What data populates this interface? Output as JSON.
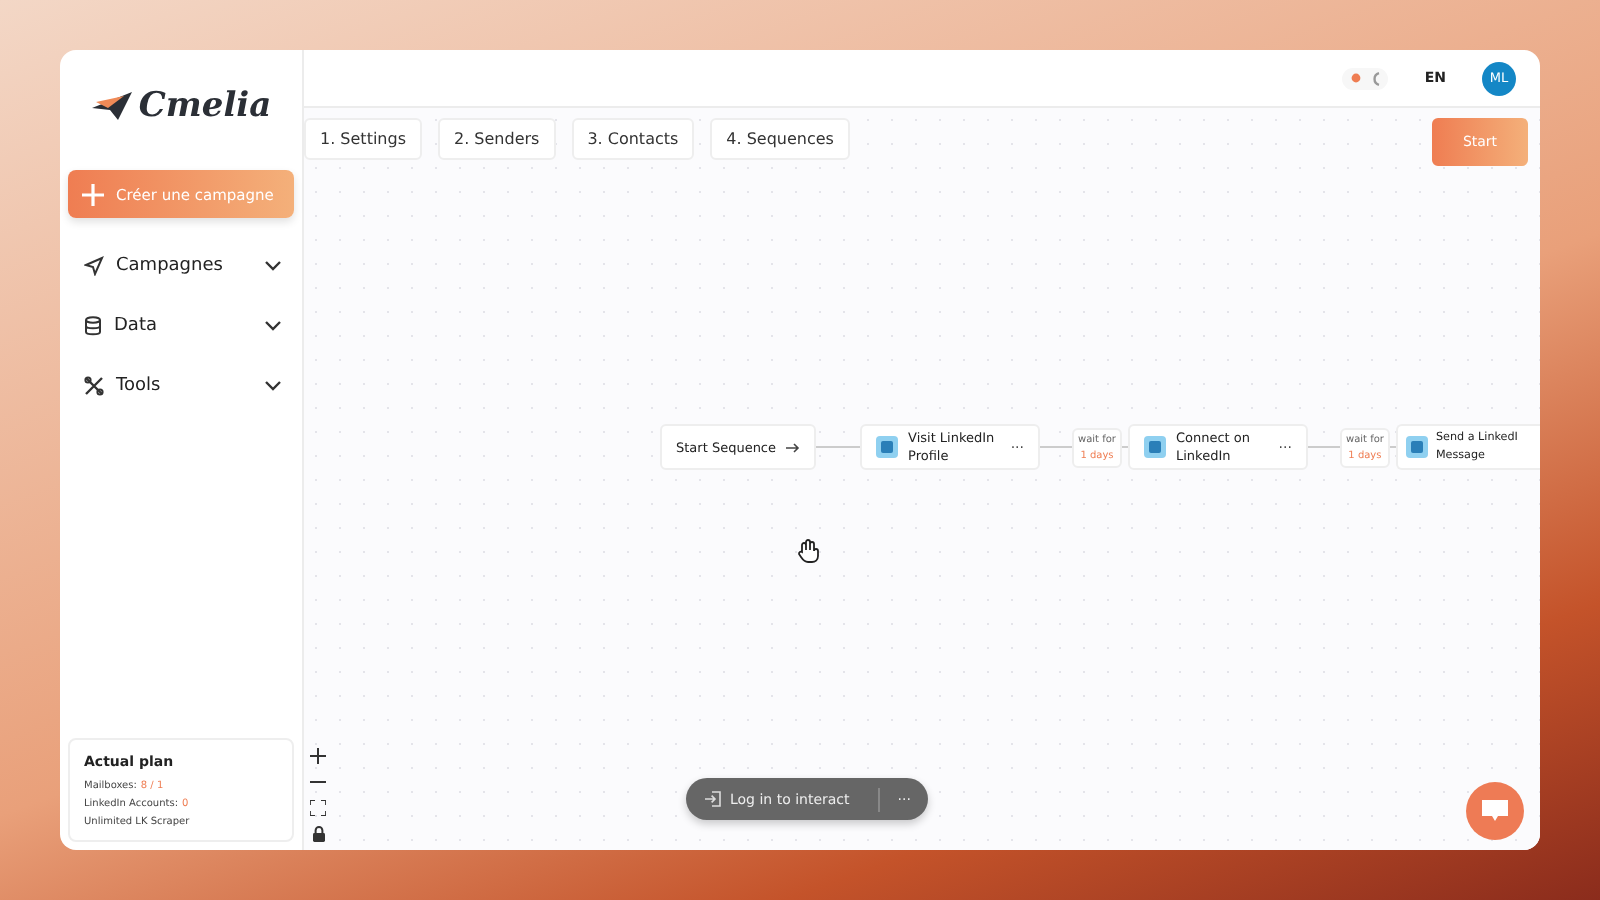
{
  "sidebar": {
    "logo_text": "Cmelia",
    "create_button": "Créer une campagne",
    "items": [
      {
        "label": "Campagnes",
        "kind": "send",
        "expanded": false
      },
      {
        "label": "Data",
        "kind": "database",
        "expanded": false
      },
      {
        "label": "Tools",
        "kind": "tools",
        "expanded": false
      }
    ],
    "plan": {
      "title": "Actual plan",
      "rows": [
        {
          "label": "Mailboxes:",
          "value": "8 / 1"
        },
        {
          "label": "LinkedIn Accounts:",
          "value": "0"
        },
        {
          "label": "Unlimited LK Scraper"
        }
      ]
    }
  },
  "topbar": {
    "dark_mode": false,
    "language": "EN",
    "avatar": "ML"
  },
  "steps": [
    {
      "label": "1. Settings"
    },
    {
      "label": "2. Senders"
    },
    {
      "label": "3. Contacts"
    },
    {
      "label": "4. Sequences"
    }
  ],
  "start_button": "Start",
  "flow": {
    "start": "Start Sequence",
    "nodes": [
      {
        "lines": [
          "Visit LinkedIn",
          "Profile"
        ],
        "menu": "···"
      },
      {
        "wait_label": "wait for",
        "wait_value": "1 days",
        "lines": [
          "Connect on",
          "LinkedIn"
        ],
        "menu": "···"
      },
      {
        "wait_label": "wait for",
        "wait_value": "1 days",
        "lines": [
          "Send a LinkedI",
          "Message"
        ]
      }
    ]
  },
  "login_bar": {
    "label": "Log in to interact",
    "menu": "···"
  }
}
